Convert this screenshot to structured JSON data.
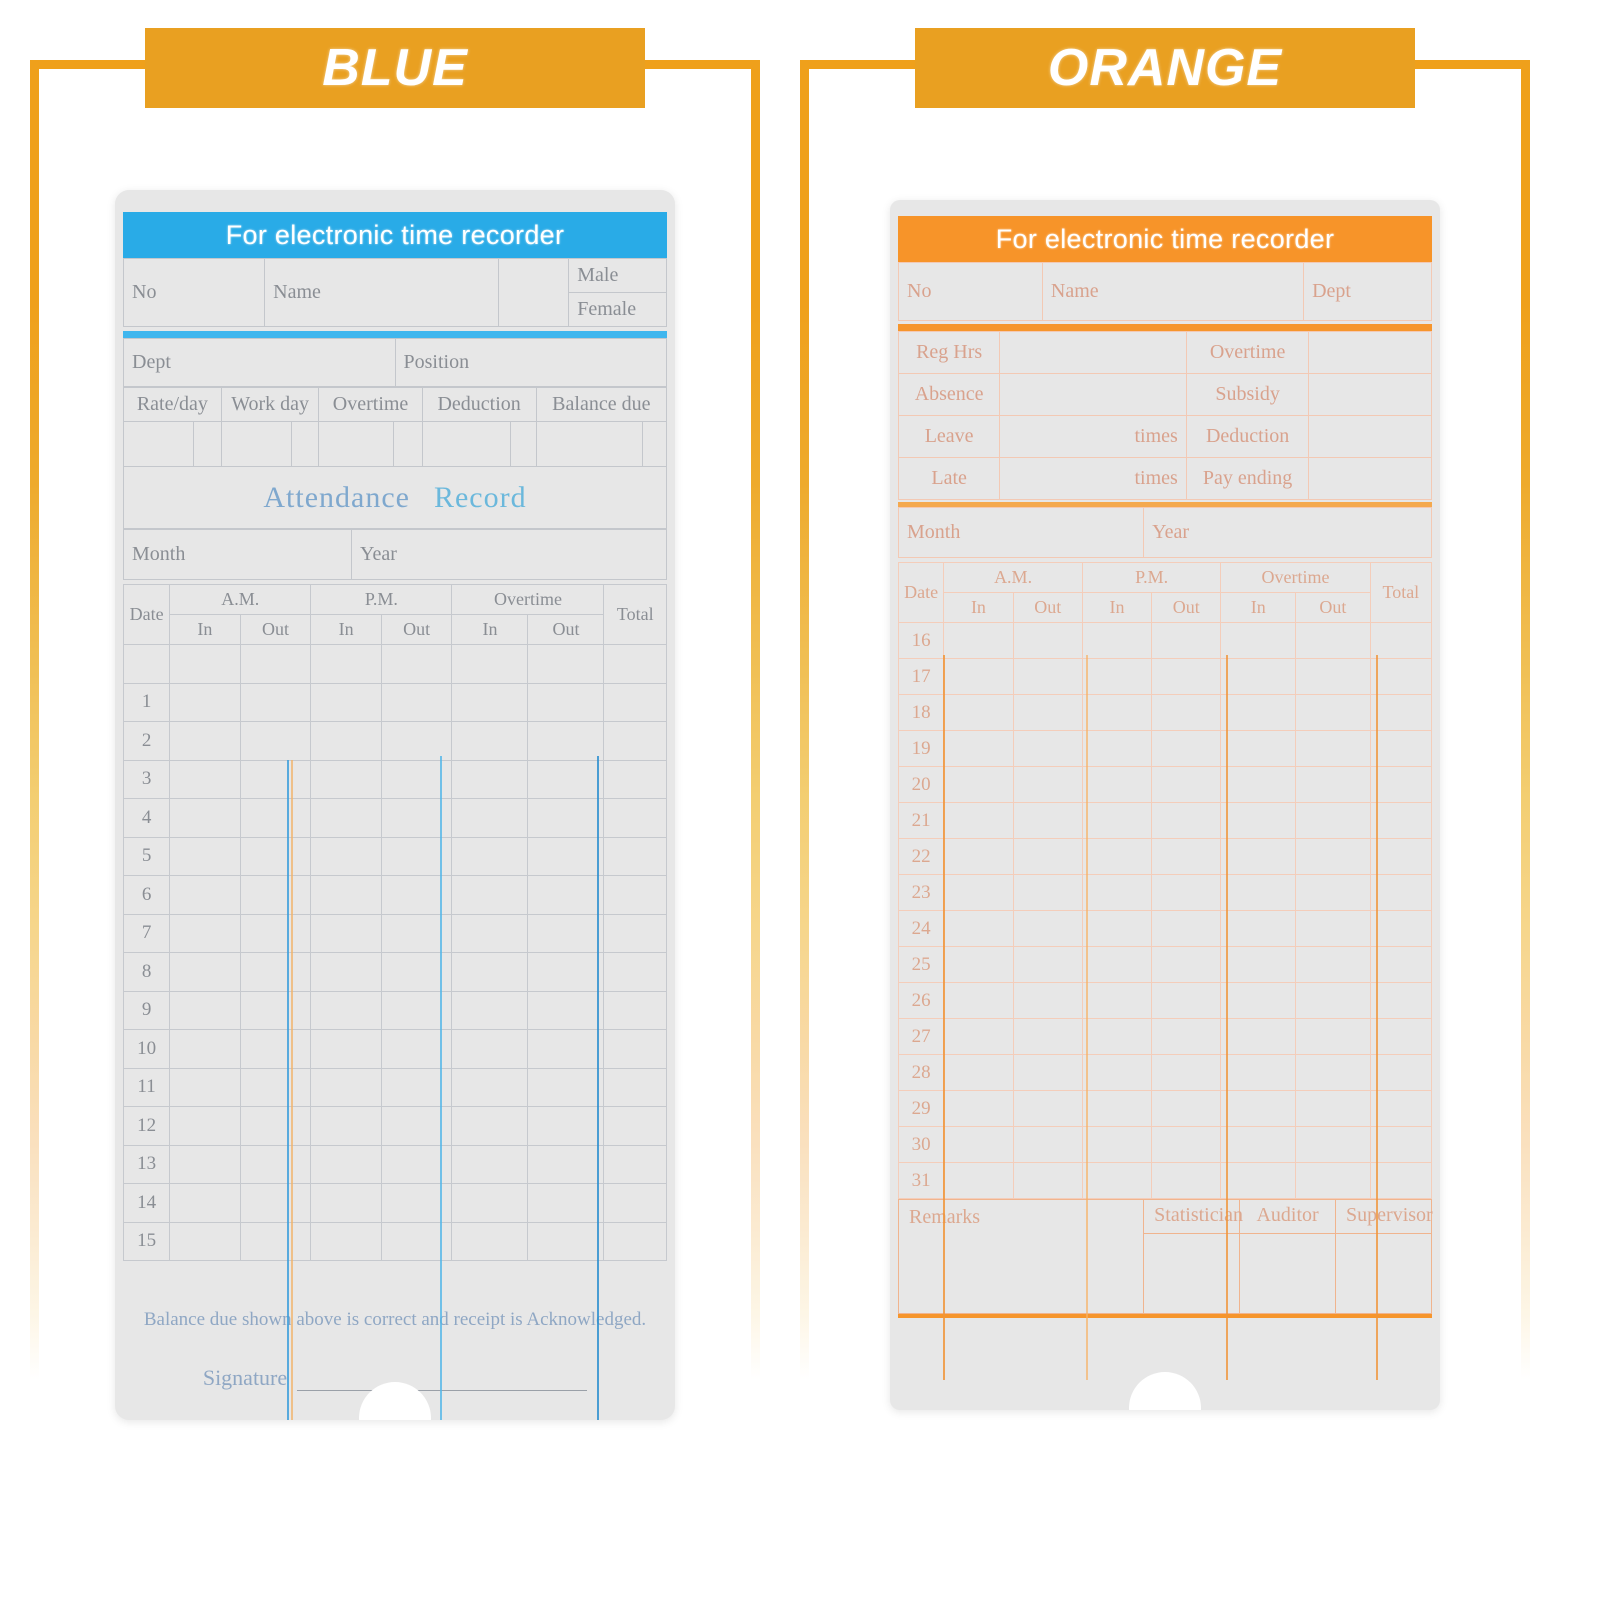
{
  "panels": [
    {
      "banner_label": "BLUE",
      "accent_color": "#29ABE7",
      "card": {
        "header_title": "For electronic time recorder",
        "fields": {
          "no": "No",
          "name": "Name",
          "male": "Male",
          "female": "Female",
          "dept": "Dept",
          "position": "Position"
        },
        "pay_headers": [
          "Rate/day",
          "Work day",
          "Overtime",
          "Deduction",
          "Balance due"
        ],
        "attendance_title_word1": "Attendance",
        "attendance_title_word2": "Record",
        "month_label": "Month",
        "year_label": "Year",
        "table": {
          "date_header": "Date",
          "groups": [
            "A.M.",
            "P.M.",
            "Overtime"
          ],
          "sub_headers": [
            "In",
            "Out",
            "In",
            "Out",
            "In",
            "Out"
          ],
          "total_header": "Total",
          "dates": [
            "",
            "1",
            "2",
            "3",
            "4",
            "5",
            "6",
            "7",
            "8",
            "9",
            "10",
            "11",
            "12",
            "13",
            "14",
            "15"
          ]
        },
        "footer_note": "Balance due shown above is correct and receipt is Acknowledged.",
        "signature_label": "Signature"
      }
    },
    {
      "banner_label": "ORANGE",
      "accent_color": "#F79429",
      "card": {
        "header_title": "For electronic time recorder",
        "fields": {
          "no": "No",
          "name": "Name",
          "dept": "Dept"
        },
        "summary_rows": [
          {
            "left_label": "Reg Hrs",
            "unit": "",
            "right_label": "Overtime"
          },
          {
            "left_label": "Absence",
            "unit": "",
            "right_label": "Subsidy"
          },
          {
            "left_label": "Leave",
            "unit": "times",
            "right_label": "Deduction"
          },
          {
            "left_label": "Late",
            "unit": "times",
            "right_label": "Pay ending"
          }
        ],
        "month_label": "Month",
        "year_label": "Year",
        "table": {
          "date_header": "Date",
          "groups": [
            "A.M.",
            "P.M.",
            "Overtime"
          ],
          "sub_headers": [
            "In",
            "Out",
            "In",
            "Out",
            "In",
            "Out"
          ],
          "total_header": "Total",
          "dates": [
            "16",
            "17",
            "18",
            "19",
            "20",
            "21",
            "22",
            "23",
            "24",
            "25",
            "26",
            "27",
            "28",
            "29",
            "30",
            "31"
          ]
        },
        "remarks_label": "Remarks",
        "signoff_headers": [
          "Statistician",
          "Auditor",
          "Supervisor"
        ]
      }
    }
  ]
}
